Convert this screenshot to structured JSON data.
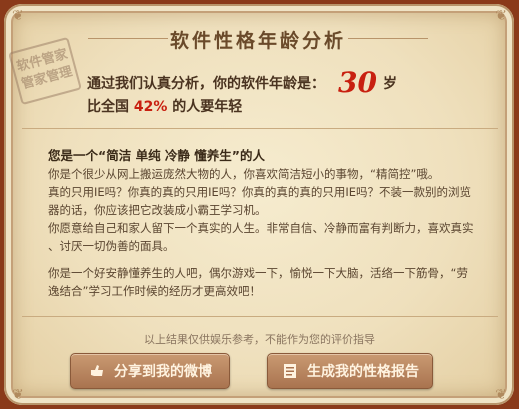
{
  "header": {
    "title": "软件性格年龄分析"
  },
  "stamp": {
    "line1": "软件管家",
    "line2": "管家管理"
  },
  "result": {
    "prefix": "通过我们认真分析，你的软件年龄是：",
    "age": "30",
    "unit": "岁",
    "compare_prefix": "比全国",
    "percent": "42%",
    "compare_suffix": "的人要年轻"
  },
  "description": {
    "title": "您是一个“简洁 单纯 冷静 懂养生”的人",
    "lines": [
      "你是个很少从网上搬运庞然大物的人，你喜欢简洁短小的事物，“精简控”哦。",
      "真的只用IE吗？你真的真的只用IE吗？你真的真的真的只用IE吗？不装一款别的浏览",
      "器的话，你应该把它改装成小霸王学习机。",
      "你愿意给自己和家人留下一个真实的人生。非常自信、冷静而富有判断力，喜欢真实",
      "、讨厌一切伪善的面具。",
      "你是一个好安静懂养生的人吧，偶尔游戏一下，愉悦一下大脑，活络一下筋骨，“劳",
      "逸结合”学习工作时候的经历才更高效吧！"
    ]
  },
  "footer": {
    "note": "以上结果仅供娱乐参考，不能作为您的评价指导",
    "share_button": "分享到我的微博",
    "report_button": "生成我的性格报告"
  },
  "colors": {
    "accent": "#c82010",
    "button": "#a9734f",
    "background": "#f2e5c4"
  }
}
